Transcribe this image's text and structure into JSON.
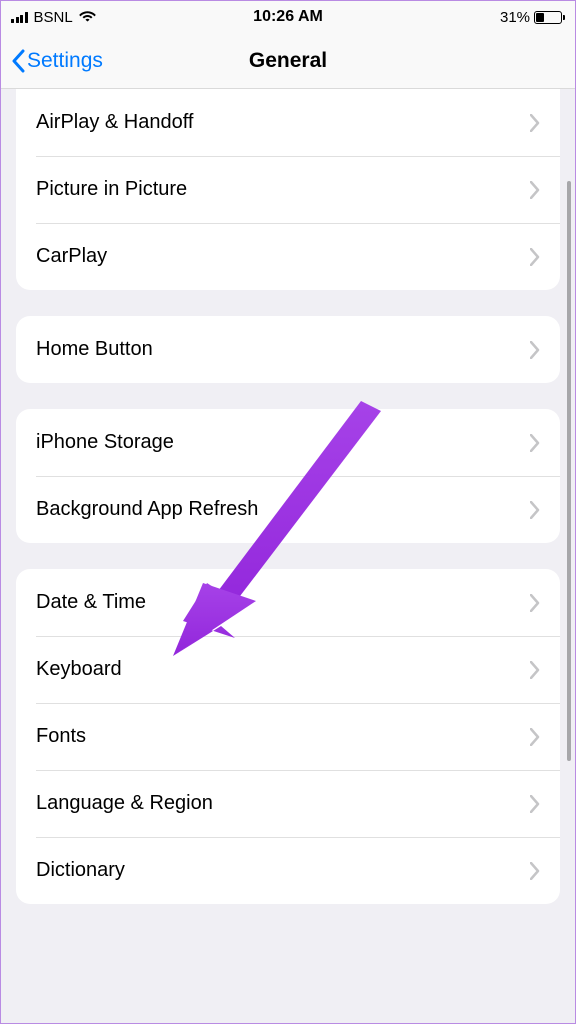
{
  "status": {
    "carrier": "BSNL",
    "time": "10:26 AM",
    "battery_pct": "31%"
  },
  "nav": {
    "back_label": "Settings",
    "title": "General"
  },
  "group1": {
    "items": [
      {
        "label": "AirPlay & Handoff"
      },
      {
        "label": "Picture in Picture"
      },
      {
        "label": "CarPlay"
      }
    ]
  },
  "group2": {
    "items": [
      {
        "label": "Home Button"
      }
    ]
  },
  "group3": {
    "items": [
      {
        "label": "iPhone Storage"
      },
      {
        "label": "Background App Refresh"
      }
    ]
  },
  "group4": {
    "items": [
      {
        "label": "Date & Time"
      },
      {
        "label": "Keyboard"
      },
      {
        "label": "Fonts"
      },
      {
        "label": "Language & Region"
      },
      {
        "label": "Dictionary"
      }
    ]
  },
  "annotation": {
    "color": "#9b30e8"
  }
}
